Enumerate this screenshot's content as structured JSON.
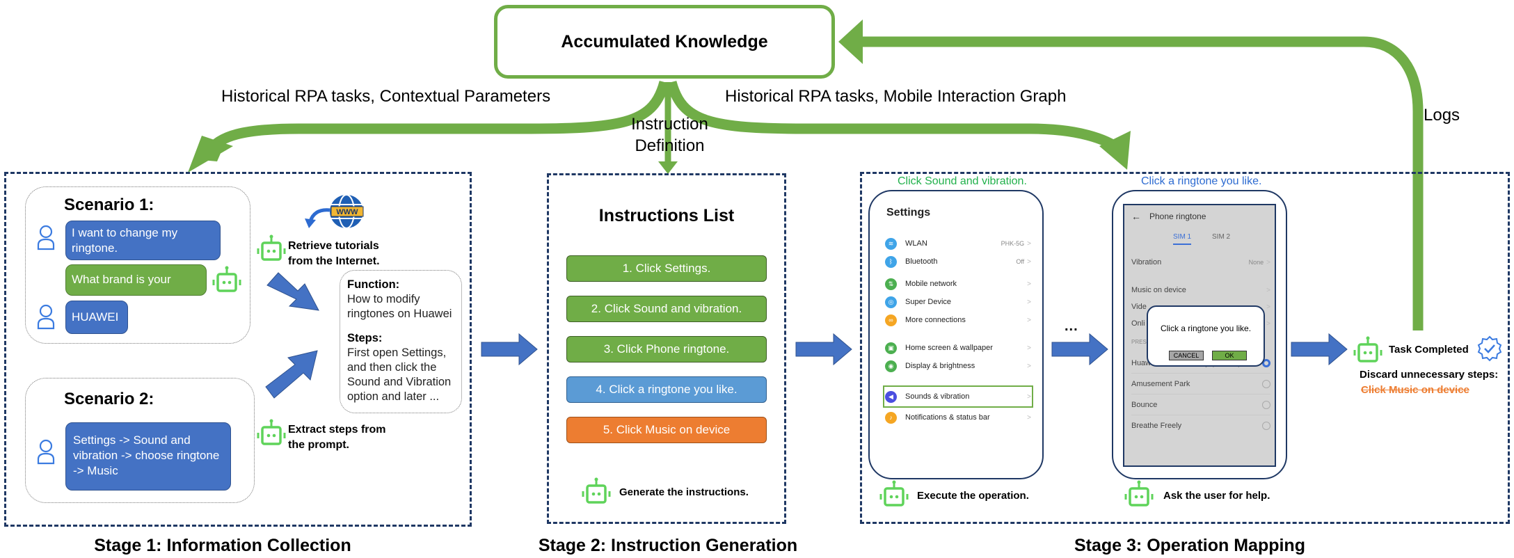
{
  "knowledge": {
    "title": "Accumulated Knowledge",
    "left_flow_label": "Historical RPA tasks,  Contextual Parameters",
    "right_flow_label": "Historical RPA tasks,  Mobile Interaction Graph",
    "center_flow_label_line1": "Instruction",
    "center_flow_label_line2": "Definition",
    "logs_label": "Logs"
  },
  "colors": {
    "green": "#70ad47",
    "blue": "#4472c4",
    "light_blue": "#5b9bd5",
    "orange": "#ed7d31",
    "navy": "#1f3864",
    "robot_green": "#5fd35a"
  },
  "stage1": {
    "caption": "Stage 1: Information Collection",
    "scenario1": {
      "title": "Scenario 1:",
      "user_msg_1": "I want to change my ringtone.",
      "bot_msg": "What brand is your phone?",
      "user_msg_2": "HUAWEI"
    },
    "scenario2": {
      "title": "Scenario 2:",
      "user_msg": "Settings -> Sound and vibration -> choose ringtone -> Music"
    },
    "retrieve_caption_1": "Retrieve tutorials",
    "retrieve_caption_2": "from the Internet.",
    "globe_label": "WWW",
    "extract_caption_1": "Extract steps from",
    "extract_caption_2": "the prompt.",
    "function_box": {
      "function_label": "Function:",
      "function_text": "How to modify ringtones on Huawei",
      "steps_label": "Steps:",
      "steps_text": "First open Settings, and then click the Sound and Vibration option and later ..."
    }
  },
  "stage2": {
    "caption": "Stage 2: Instruction Generation",
    "title": "Instructions List",
    "instructions": [
      {
        "text": "1. Click Settings.",
        "status": "green"
      },
      {
        "text": "2. Click Sound and vibration.",
        "status": "green"
      },
      {
        "text": "3. Click Phone ringtone.",
        "status": "green"
      },
      {
        "text": "4. Click a ringtone you like.",
        "status": "blue"
      },
      {
        "text": "5. Click Music on device",
        "status": "orange"
      }
    ],
    "robot_caption": "Generate the instructions."
  },
  "stage3": {
    "caption": "Stage 3: Operation Mapping",
    "phone1": {
      "caption": "Click Sound and vibration.",
      "title": "Settings",
      "rows": [
        {
          "label": "WLAN",
          "value": "PHK-5G",
          "icon": "wifi-icon",
          "color": "#3fa4e8"
        },
        {
          "label": "Bluetooth",
          "value": "Off",
          "icon": "bluetooth-icon",
          "color": "#3fa4e8"
        },
        {
          "label": "Mobile network",
          "value": "",
          "icon": "mobile-network-icon",
          "color": "#4caf50"
        },
        {
          "label": "Super Device",
          "value": "",
          "icon": "super-device-icon",
          "color": "#3fa4e8"
        },
        {
          "label": "More connections",
          "value": "",
          "icon": "link-icon",
          "color": "#f5a623"
        },
        {
          "label": "Home screen & wallpaper",
          "value": "",
          "icon": "wallpaper-icon",
          "color": "#4caf50"
        },
        {
          "label": "Display & brightness",
          "value": "",
          "icon": "eye-icon",
          "color": "#4caf50"
        },
        {
          "label": "Sounds & vibration",
          "value": "",
          "icon": "speaker-icon",
          "color": "#4b4fe0"
        },
        {
          "label": "Notifications & status bar",
          "value": "",
          "icon": "bell-icon",
          "color": "#f5a623"
        }
      ],
      "robot_caption": "Execute the operation."
    },
    "ellipsis": "...",
    "phone2": {
      "caption": "Click a ringtone you like.",
      "back_arrow": "←",
      "title": "Phone ringtone",
      "tab_sim1": "SIM 1",
      "tab_sim2": "SIM 2",
      "vibration_label": "Vibration",
      "vibration_value": "None",
      "music_label": "Music on device",
      "video_label": "Vide",
      "online_label": "Onli",
      "preset_label": "PRES",
      "ringtones": [
        {
          "label": "Huawei Tune Harmony (Default)",
          "selected": true
        },
        {
          "label": "Amusement Park",
          "selected": false
        },
        {
          "label": "Bounce",
          "selected": false
        },
        {
          "label": "Breathe Freely",
          "selected": false
        }
      ],
      "dialog": {
        "text": "Click a ringtone you like.",
        "cancel": "CANCEL",
        "ok": "OK"
      },
      "robot_caption": "Ask the user for help."
    },
    "task_completed": "Task Completed",
    "discard_label": "Discard unnecessary steps:",
    "discarded_step": "Click Music on device"
  }
}
